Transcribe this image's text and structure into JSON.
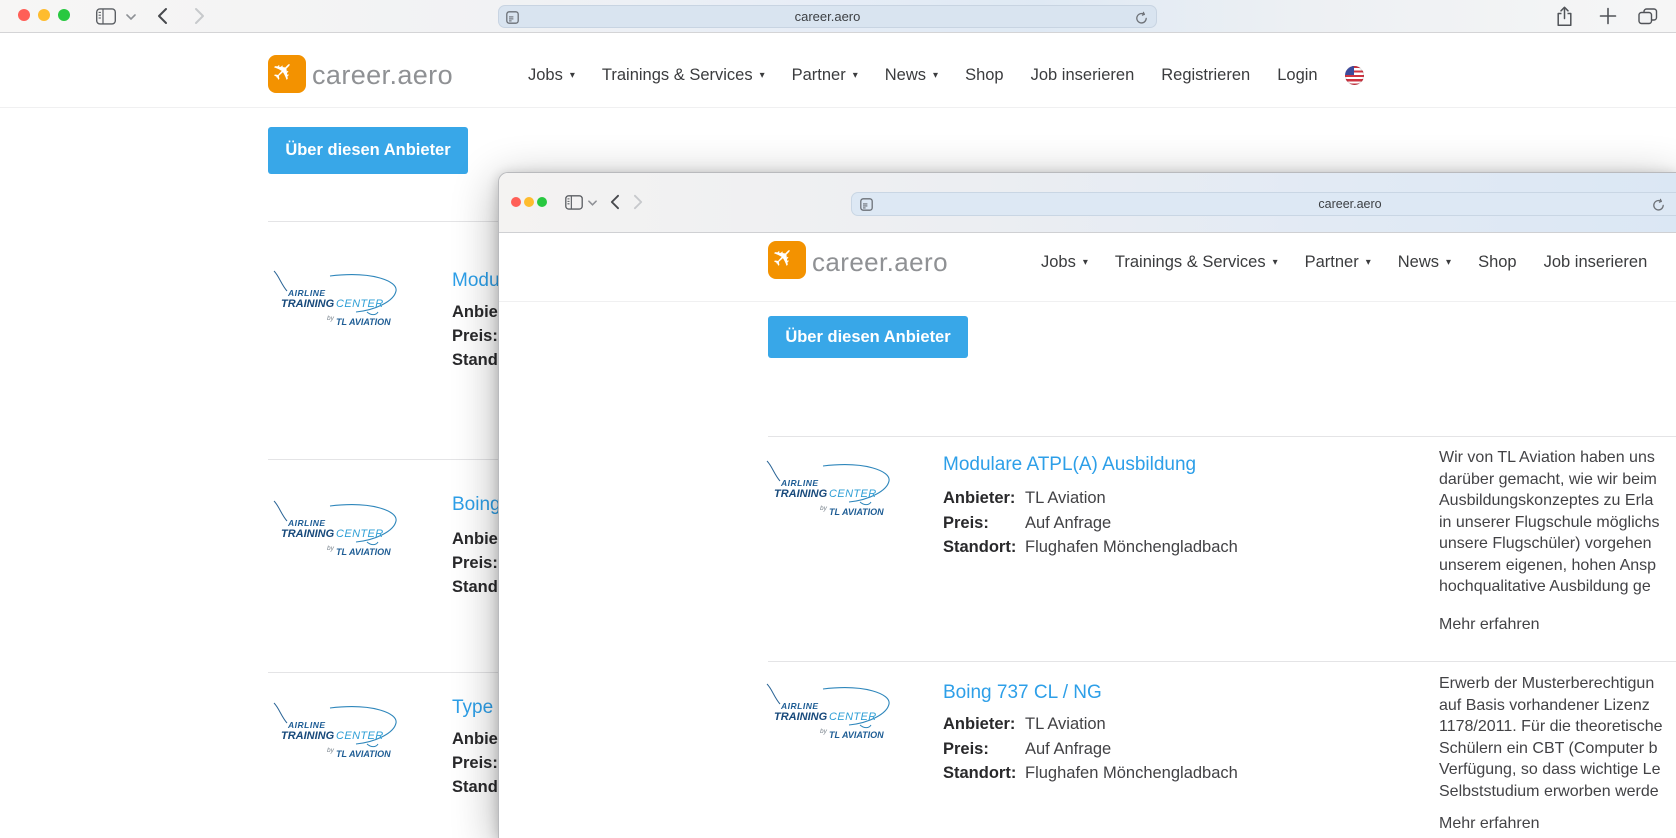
{
  "chrome": {
    "url": "career.aero",
    "plus_glyph": "+"
  },
  "inner_chrome": {
    "url": "career.aero"
  },
  "site": {
    "brand": "career.aero",
    "plane": "✈",
    "caret": "▾",
    "nav": [
      "Jobs",
      "Trainings & Services",
      "Partner",
      "News",
      "Shop",
      "Job inserieren",
      "Registrieren",
      "Login"
    ],
    "colors": {
      "brand_orange": "#f39200",
      "link_blue": "#2d9fe8",
      "button_blue": "#38a7e8"
    }
  },
  "atc_logo": {
    "airline": "AIRLINE",
    "training": "TRAINING",
    "center": "CENTER",
    "by": "by",
    "brand": "TL AVIATION"
  },
  "bg_page": {
    "provider_button": "Über diesen Anbieter",
    "listings": [
      {
        "title": "Modu",
        "rows": [
          "Anbie",
          "Preis:",
          "Stand"
        ]
      },
      {
        "title": "Boing",
        "rows": [
          "Anbie",
          "Preis:",
          "Stand"
        ]
      },
      {
        "title": "Type",
        "rows": [
          "Anbie",
          "Preis:",
          "Stand"
        ]
      }
    ]
  },
  "inner_page": {
    "provider_button": "Über diesen Anbieter",
    "listings": [
      {
        "title": "Modulare ATPL(A) Ausbildung",
        "fields": [
          {
            "label": "Anbieter:",
            "value": "TL Aviation"
          },
          {
            "label": "Preis:",
            "value": "Auf Anfrage"
          },
          {
            "label": "Standort:",
            "value": "Flughafen Mönchengladbach"
          }
        ],
        "desc": [
          "Wir von TL Aviation haben uns",
          "darüber gemacht, wie wir beim",
          "Ausbildungskonzeptes zu Erla",
          "in unserer Flugschule möglichs",
          "unsere Flugschüler) vorgehen",
          "unserem eigenen, hohen Ansp",
          "hochqualitative Ausbildung ge"
        ],
        "more": "Mehr erfahren"
      },
      {
        "title": "Boing 737 CL / NG",
        "fields": [
          {
            "label": "Anbieter:",
            "value": "TL Aviation"
          },
          {
            "label": "Preis:",
            "value": "Auf Anfrage"
          },
          {
            "label": "Standort:",
            "value": "Flughafen Mönchengladbach"
          }
        ],
        "desc": [
          "Erwerb der Musterberechtigun",
          "auf Basis vorhandener Lizenz",
          "1178/2011. Für die theoretische",
          "Schülern ein CBT (Computer b",
          "Verfügung, so dass wichtige Le",
          "Selbststudium erworben werde"
        ],
        "more": "Mehr erfahren"
      }
    ]
  }
}
